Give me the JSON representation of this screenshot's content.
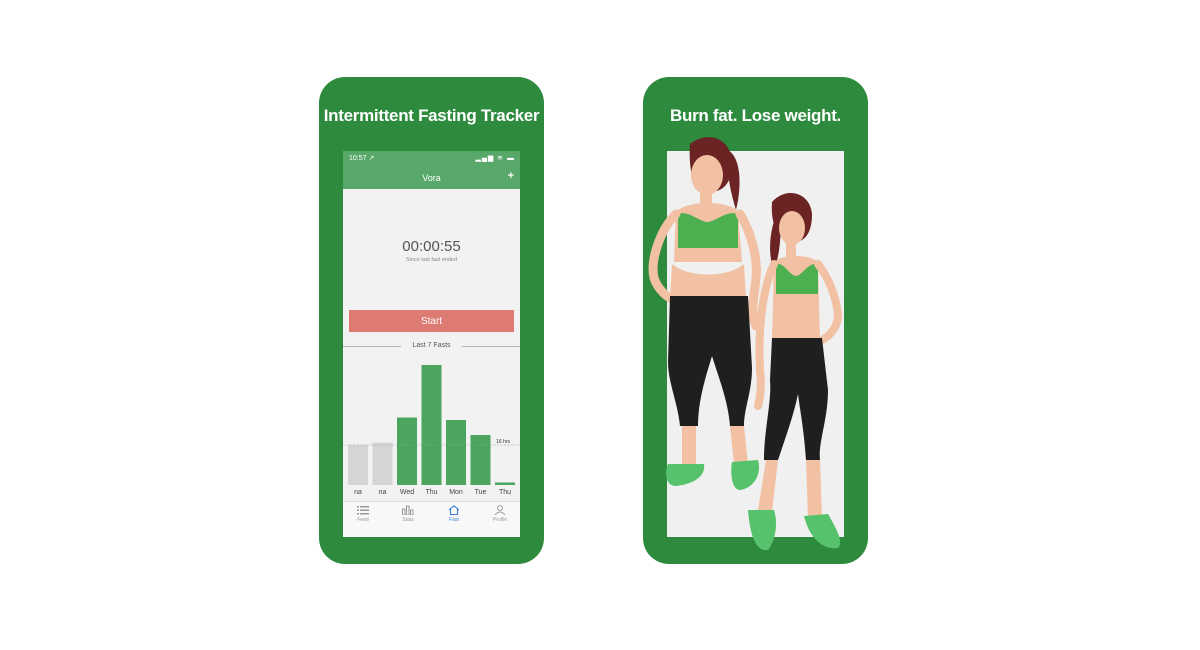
{
  "left_card": {
    "title": "Intermittent Fasting Tracker",
    "status_bar": {
      "time": "10:57 ↗",
      "icons": "▂▄▆ ≋ ▬"
    },
    "nav": {
      "title": "Vora",
      "add_label": "+"
    },
    "timer": {
      "value": "00:00:55",
      "caption": "Since last fast ended"
    },
    "start_button": "Start",
    "section_label": "Last 7 Fasts",
    "tabs": [
      {
        "label": "Feed",
        "icon": "list-icon",
        "active": false
      },
      {
        "label": "Stats",
        "icon": "bar-chart-icon",
        "active": false
      },
      {
        "label": "Fast",
        "icon": "home-icon",
        "active": true
      },
      {
        "label": "Profile",
        "icon": "person-icon",
        "active": false
      }
    ]
  },
  "right_card": {
    "title": "Burn fat. Lose weight."
  },
  "colors": {
    "card_green": "#2e8b3e",
    "header_green": "#58a86a",
    "bar_green": "#4ca55e",
    "bar_gray": "#d5d5d5",
    "start_red": "#dd7a72",
    "active_tab": "#3b7fd4"
  },
  "chart_data": {
    "type": "bar",
    "categories": [
      "na",
      "na",
      "Wed",
      "Thu",
      "Mon",
      "Tue",
      "Thu"
    ],
    "values": [
      16,
      17,
      27,
      48,
      26,
      20,
      1
    ],
    "ylim": [
      0,
      50
    ],
    "reference_line": {
      "value": 16,
      "label": "16 hrs"
    }
  }
}
